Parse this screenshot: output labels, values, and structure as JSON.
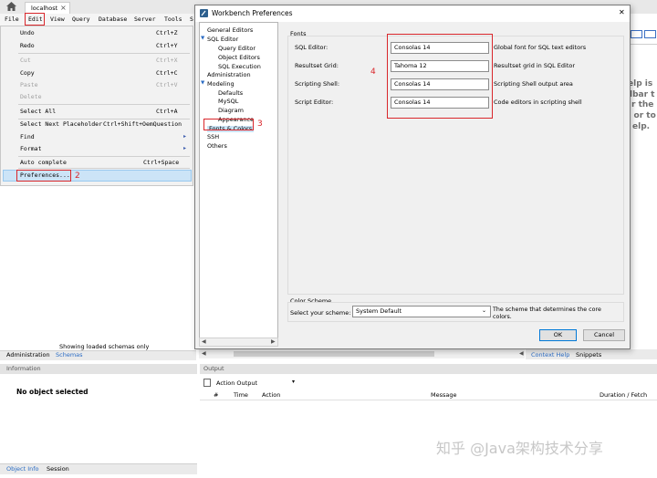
{
  "window": {
    "tab_label": "localhost",
    "tab_close": "×"
  },
  "menubar": {
    "items": [
      "File",
      "Edit",
      "View",
      "Query",
      "Database",
      "Server",
      "Tools",
      "S"
    ]
  },
  "edit_menu": {
    "items": [
      {
        "label": "Undo",
        "shortcut": "Ctrl+Z",
        "enabled": true
      },
      {
        "label": "Redo",
        "shortcut": "Ctrl+Y",
        "enabled": true
      },
      {
        "label": "Cut",
        "shortcut": "Ctrl+X",
        "enabled": false
      },
      {
        "label": "Copy",
        "shortcut": "Ctrl+C",
        "enabled": true
      },
      {
        "label": "Paste",
        "shortcut": "Ctrl+V",
        "enabled": false
      },
      {
        "label": "Delete",
        "shortcut": "",
        "enabled": false
      },
      {
        "label": "Select All",
        "shortcut": "Ctrl+A",
        "enabled": true
      },
      {
        "label": "Select Next Placeholder",
        "shortcut": "Ctrl+Shift+OemQuestion",
        "enabled": true
      },
      {
        "label": "Find",
        "shortcut": "",
        "enabled": true,
        "submenu": true
      },
      {
        "label": "Format",
        "shortcut": "",
        "enabled": true,
        "submenu": true
      },
      {
        "label": "Auto complete",
        "shortcut": "Ctrl+Space",
        "enabled": true
      },
      {
        "label": "Preferences...",
        "shortcut": "",
        "enabled": true,
        "highlighted": true
      }
    ]
  },
  "left_panel": {
    "status": "Showing loaded schemas only",
    "tabs": [
      "Administration",
      "Schemas"
    ],
    "info_header": "Information",
    "no_selection": "No object selected",
    "bottom_tabs": [
      "Object Info",
      "Session"
    ]
  },
  "dialog": {
    "title": "Workbench Preferences",
    "close": "✕",
    "tree": [
      {
        "label": "General Editors",
        "level": 0
      },
      {
        "label": "SQL Editor",
        "level": 0,
        "expanded": true
      },
      {
        "label": "Query Editor",
        "level": 1
      },
      {
        "label": "Object Editors",
        "level": 1
      },
      {
        "label": "SQL Execution",
        "level": 1
      },
      {
        "label": "Administration",
        "level": 0
      },
      {
        "label": "Modeling",
        "level": 0,
        "expanded": true
      },
      {
        "label": "Defaults",
        "level": 1
      },
      {
        "label": "MySQL",
        "level": 1
      },
      {
        "label": "Diagram",
        "level": 1
      },
      {
        "label": "Appearance",
        "level": 1
      },
      {
        "label": "Fonts & Colors",
        "level": 0,
        "selected": true
      },
      {
        "label": "SSH",
        "level": 0
      },
      {
        "label": "Others",
        "level": 0
      }
    ],
    "fonts_group": "Fonts",
    "fonts": [
      {
        "label": "SQL Editor:",
        "value": "Consolas 14",
        "desc": "Global font for SQL text editors"
      },
      {
        "label": "Resultset Grid:",
        "value": "Tahoma 12",
        "desc": "Resultset grid in SQL Editor"
      },
      {
        "label": "Scripting Shell:",
        "value": "Consolas 14",
        "desc": "Scripting Shell output area"
      },
      {
        "label": "Script Editor:",
        "value": "Consolas 14",
        "desc": "Code editors in scripting shell"
      }
    ],
    "color_group": "Color Scheme",
    "scheme_label": "Select your scheme:",
    "scheme_value": "System Default",
    "scheme_desc": "The scheme that determines the core colors.",
    "ok": "OK",
    "cancel": "Cancel"
  },
  "annotations": [
    "2",
    "3",
    "4"
  ],
  "right_help": [
    "elp is",
    "lbar t",
    "r the",
    "n or to",
    "elp."
  ],
  "bottom": {
    "context_help": "Context Help",
    "snippets": "Snippets",
    "output_header": "Output",
    "output_select": "Action Output",
    "columns": [
      "#",
      "Time",
      "Action",
      "Message",
      "Duration / Fetch"
    ]
  },
  "watermark": "知乎 @Java架构技术分享",
  "colors": {
    "accent": "#2b6cc4",
    "annotation": "#d9262b",
    "menu_highlight": "#cce4f7"
  }
}
